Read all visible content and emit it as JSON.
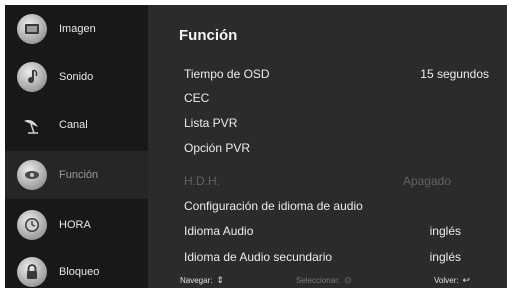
{
  "sidebar": {
    "items": [
      {
        "label": "Imagen",
        "icon": "picture-icon",
        "active": false
      },
      {
        "label": "Sonido",
        "icon": "music-note-icon",
        "active": false
      },
      {
        "label": "Canal",
        "icon": "satellite-dish-icon",
        "active": false
      },
      {
        "label": "Función",
        "icon": "function-icon",
        "active": true
      },
      {
        "label": "HORA",
        "icon": "clock-icon",
        "active": false
      },
      {
        "label": "Bloqueo",
        "icon": "lock-icon",
        "active": false
      }
    ]
  },
  "main": {
    "title": "Función",
    "rows": [
      {
        "label": "Tiempo de OSD",
        "value": "15 segundos",
        "disabled": false
      },
      {
        "label": "CEC",
        "value": "",
        "disabled": false
      },
      {
        "label": "Lista PVR",
        "value": "",
        "disabled": false
      },
      {
        "label": "Opción PVR",
        "value": "",
        "disabled": false
      },
      {
        "label": "H.D.H.",
        "value": "Apagado",
        "disabled": true
      },
      {
        "label": "Configuración de idioma de audio",
        "value": "",
        "disabled": false
      },
      {
        "label": "Idioma Audio",
        "value": "inglés",
        "disabled": false
      },
      {
        "label": "Idioma de Audio secundario",
        "value": "inglés",
        "disabled": false
      }
    ]
  },
  "footer": {
    "navigate": "Navegar:",
    "select": "Seleccionar:",
    "back": "Volver:"
  }
}
